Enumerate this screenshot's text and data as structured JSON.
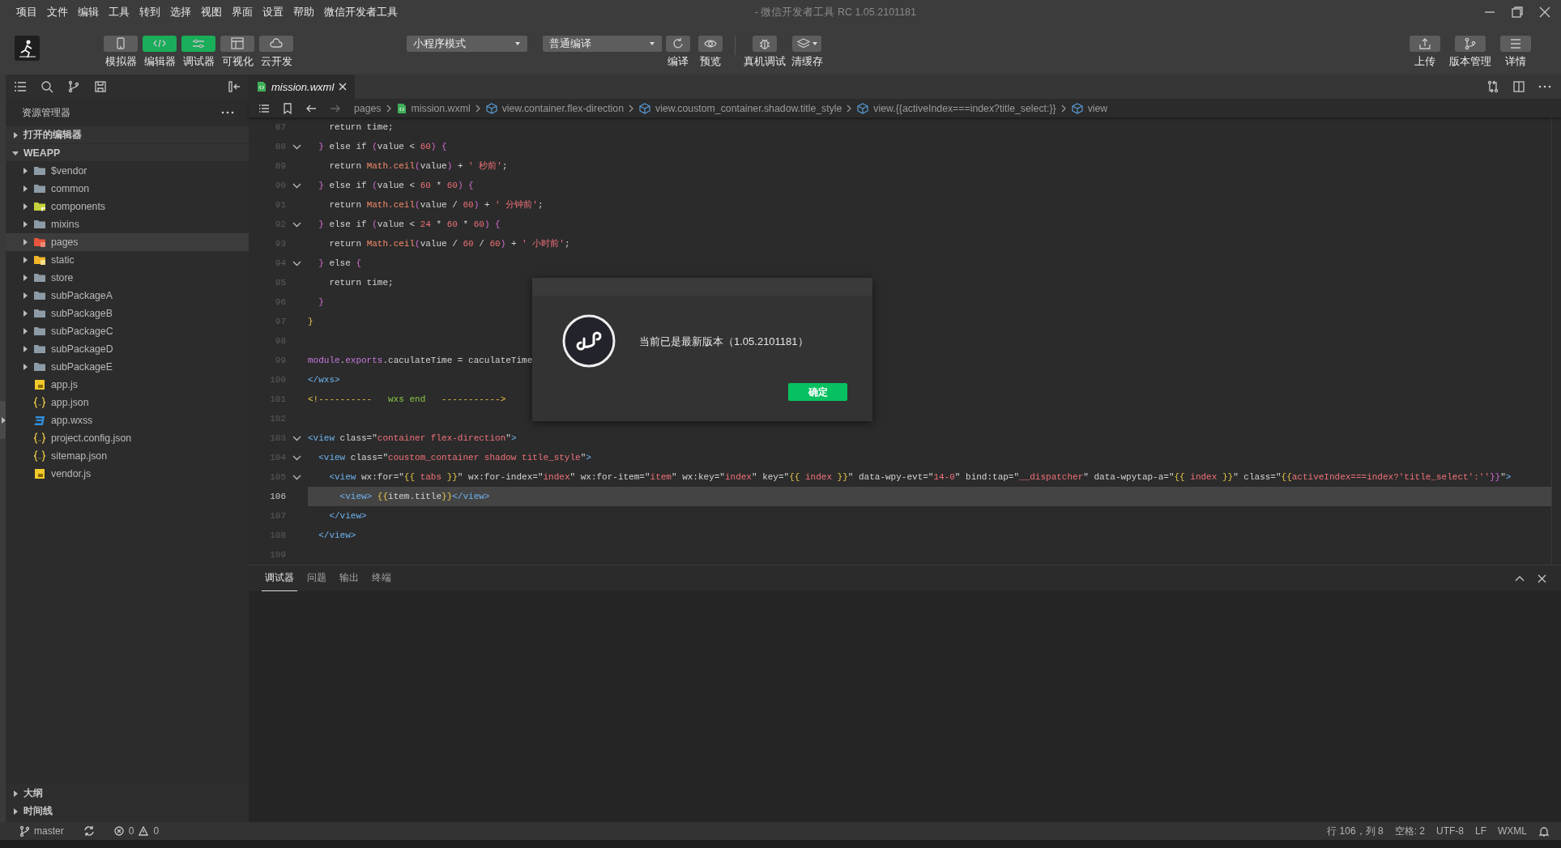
{
  "window": {
    "title": "- 微信开发者工具 RC 1.05.2101181"
  },
  "menu": [
    "项目",
    "文件",
    "编辑",
    "工具",
    "转到",
    "选择",
    "视图",
    "界面",
    "设置",
    "帮助",
    "微信开发者工具"
  ],
  "toolbar": {
    "views": [
      {
        "label": "模拟器",
        "on": false
      },
      {
        "label": "编辑器",
        "on": true
      },
      {
        "label": "调试器",
        "on": true
      },
      {
        "label": "可视化",
        "on": false
      },
      {
        "label": "云开发",
        "on": false
      }
    ],
    "mode_select": "小程序模式",
    "compile_select": "普通编译",
    "actions": [
      "编译",
      "预览",
      "真机调试",
      "清缓存"
    ],
    "right_actions": [
      "上传",
      "版本管理",
      "详情"
    ]
  },
  "sidebar": {
    "title": "资源管理器",
    "sections": [
      {
        "label": "打开的编辑器",
        "expanded": false
      },
      {
        "label": "WEAPP",
        "expanded": true
      }
    ],
    "items": [
      {
        "name": "$vendor",
        "kind": "folder",
        "selected": false
      },
      {
        "name": "common",
        "kind": "folder",
        "selected": false
      },
      {
        "name": "components",
        "kind": "components",
        "selected": false
      },
      {
        "name": "mixins",
        "kind": "folder",
        "selected": false
      },
      {
        "name": "pages",
        "kind": "pages",
        "selected": true
      },
      {
        "name": "static",
        "kind": "static",
        "selected": false
      },
      {
        "name": "store",
        "kind": "folder",
        "selected": false
      },
      {
        "name": "subPackageA",
        "kind": "folder",
        "selected": false
      },
      {
        "name": "subPackageB",
        "kind": "folder",
        "selected": false
      },
      {
        "name": "subPackageC",
        "kind": "folder",
        "selected": false
      },
      {
        "name": "subPackageD",
        "kind": "folder",
        "selected": false
      },
      {
        "name": "subPackageE",
        "kind": "folder",
        "selected": false
      },
      {
        "name": "app.js",
        "kind": "js",
        "selected": false
      },
      {
        "name": "app.json",
        "kind": "json",
        "selected": false
      },
      {
        "name": "app.wxss",
        "kind": "wxss",
        "selected": false
      },
      {
        "name": "project.config.json",
        "kind": "json",
        "selected": false
      },
      {
        "name": "sitemap.json",
        "kind": "json",
        "selected": false
      },
      {
        "name": "vendor.js",
        "kind": "js",
        "selected": false
      }
    ],
    "bottom_sections": [
      {
        "label": "大纲",
        "expanded": false
      },
      {
        "label": "时间线",
        "expanded": false
      }
    ]
  },
  "editor": {
    "tabs": [
      {
        "label": "mission.wxml",
        "selected": true
      }
    ],
    "breadcrumb": [
      {
        "label": "pages",
        "kind": "folder"
      },
      {
        "label": "mission.wxml",
        "kind": "file"
      },
      {
        "label": "view.container.flex-direction",
        "kind": "element"
      },
      {
        "label": "view.coustom_container.shadow.title_style",
        "kind": "element"
      },
      {
        "label": "view.{{activeIndex===index?title_select:}}",
        "kind": "element"
      },
      {
        "label": "view",
        "kind": "element"
      }
    ],
    "lines": [
      {
        "number": "87",
        "fold": false,
        "current": false,
        "tokens": [
          {
            "kind": "t",
            "text": "    return time;"
          }
        ]
      },
      {
        "number": "88",
        "fold": true,
        "current": false,
        "tokens": [
          {
            "kind": "br",
            "text": "  }"
          },
          {
            "kind": "t",
            "text": " else if "
          },
          {
            "kind": "br",
            "text": "("
          },
          {
            "kind": "t",
            "text": "value < "
          },
          {
            "kind": "num",
            "text": "60"
          },
          {
            "kind": "br",
            "text": ") {"
          }
        ]
      },
      {
        "number": "89",
        "fold": false,
        "current": false,
        "tokens": [
          {
            "kind": "t",
            "text": "    return "
          },
          {
            "kind": "fn",
            "text": "Math.ceil"
          },
          {
            "kind": "br",
            "text": "("
          },
          {
            "kind": "t",
            "text": "value"
          },
          {
            "kind": "br",
            "text": ")"
          },
          {
            "kind": "t",
            "text": " + "
          },
          {
            "kind": "str",
            "text": "' 秒前'"
          },
          {
            "kind": "t",
            "text": ";"
          }
        ]
      },
      {
        "number": "90",
        "fold": true,
        "current": false,
        "tokens": [
          {
            "kind": "br",
            "text": "  }"
          },
          {
            "kind": "t",
            "text": " else if "
          },
          {
            "kind": "br",
            "text": "("
          },
          {
            "kind": "t",
            "text": "value < "
          },
          {
            "kind": "num",
            "text": "60"
          },
          {
            "kind": "t",
            "text": " * "
          },
          {
            "kind": "num",
            "text": "60"
          },
          {
            "kind": "br",
            "text": ") {"
          }
        ]
      },
      {
        "number": "91",
        "fold": false,
        "current": false,
        "tokens": [
          {
            "kind": "t",
            "text": "    return "
          },
          {
            "kind": "fn",
            "text": "Math.ceil"
          },
          {
            "kind": "br",
            "text": "("
          },
          {
            "kind": "t",
            "text": "value / "
          },
          {
            "kind": "num",
            "text": "60"
          },
          {
            "kind": "br",
            "text": ")"
          },
          {
            "kind": "t",
            "text": " + "
          },
          {
            "kind": "str",
            "text": "' 分钟前'"
          },
          {
            "kind": "t",
            "text": ";"
          }
        ]
      },
      {
        "number": "92",
        "fold": true,
        "current": false,
        "tokens": [
          {
            "kind": "br",
            "text": "  }"
          },
          {
            "kind": "t",
            "text": " else if "
          },
          {
            "kind": "br",
            "text": "("
          },
          {
            "kind": "t",
            "text": "value < "
          },
          {
            "kind": "num",
            "text": "24"
          },
          {
            "kind": "t",
            "text": " * "
          },
          {
            "kind": "num",
            "text": "60"
          },
          {
            "kind": "t",
            "text": " * "
          },
          {
            "kind": "num",
            "text": "60"
          },
          {
            "kind": "br",
            "text": ") {"
          }
        ]
      },
      {
        "number": "93",
        "fold": false,
        "current": false,
        "tokens": [
          {
            "kind": "t",
            "text": "    return "
          },
          {
            "kind": "fn",
            "text": "Math.ceil"
          },
          {
            "kind": "br",
            "text": "("
          },
          {
            "kind": "t",
            "text": "value / "
          },
          {
            "kind": "num",
            "text": "60"
          },
          {
            "kind": "t",
            "text": " / "
          },
          {
            "kind": "num",
            "text": "60"
          },
          {
            "kind": "br",
            "text": ")"
          },
          {
            "kind": "t",
            "text": " + "
          },
          {
            "kind": "str",
            "text": "' 小时前'"
          },
          {
            "kind": "t",
            "text": ";"
          }
        ]
      },
      {
        "number": "94",
        "fold": true,
        "current": false,
        "tokens": [
          {
            "kind": "br",
            "text": "  }"
          },
          {
            "kind": "t",
            "text": " else "
          },
          {
            "kind": "br",
            "text": "{"
          }
        ]
      },
      {
        "number": "95",
        "fold": false,
        "current": false,
        "tokens": [
          {
            "kind": "t",
            "text": "    return time;"
          }
        ]
      },
      {
        "number": "96",
        "fold": false,
        "current": false,
        "tokens": [
          {
            "kind": "br",
            "text": "  }"
          }
        ]
      },
      {
        "number": "97",
        "fold": false,
        "current": false,
        "tokens": [
          {
            "kind": "br2",
            "text": "}"
          }
        ]
      },
      {
        "number": "98",
        "fold": false,
        "current": false
      },
      {
        "number": "99",
        "fold": false,
        "current": false,
        "tokens": [
          {
            "kind": "mod",
            "text": "module"
          },
          {
            "kind": "t",
            "text": "."
          },
          {
            "kind": "mod",
            "text": "exports"
          },
          {
            "kind": "t",
            "text": ".caculateTime = caculateTime"
          }
        ]
      },
      {
        "number": "100",
        "fold": false,
        "current": false,
        "tokens": [
          {
            "kind": "tag",
            "text": "</wxs>"
          }
        ]
      },
      {
        "number": "101",
        "fold": false,
        "current": false,
        "tokens": [
          {
            "kind": "cm",
            "text": "<!----------"
          },
          {
            "kind": "cg",
            "text": "   wxs end   "
          },
          {
            "kind": "cm",
            "text": "----------->"
          }
        ]
      },
      {
        "number": "102",
        "fold": false,
        "current": false
      },
      {
        "number": "103",
        "fold": true,
        "current": false,
        "tokens": [
          {
            "kind": "tag",
            "text": "<view"
          },
          {
            "kind": "t",
            "text": " class=\""
          },
          {
            "kind": "str",
            "text": "container flex-direction"
          },
          {
            "kind": "t",
            "text": "\""
          },
          {
            "kind": "tag",
            "text": ">"
          }
        ]
      },
      {
        "number": "104",
        "fold": true,
        "current": false,
        "tokens": [
          {
            "kind": "tag",
            "text": "  <view"
          },
          {
            "kind": "t",
            "text": " class=\""
          },
          {
            "kind": "str",
            "text": "coustom_container shadow title_style"
          },
          {
            "kind": "t",
            "text": "\""
          },
          {
            "kind": "tag",
            "text": ">"
          }
        ]
      },
      {
        "number": "105",
        "fold": true,
        "current": false,
        "tokens": [
          {
            "kind": "tag",
            "text": "    <view"
          },
          {
            "kind": "t",
            "text": " wx:for=\""
          },
          {
            "kind": "br2",
            "text": "{{"
          },
          {
            "kind": "str",
            "text": " tabs "
          },
          {
            "kind": "br2",
            "text": "}}"
          },
          {
            "kind": "t",
            "text": "\" wx:for-index=\""
          },
          {
            "kind": "str",
            "text": "index"
          },
          {
            "kind": "t",
            "text": "\" wx:for-item=\""
          },
          {
            "kind": "str",
            "text": "item"
          },
          {
            "kind": "t",
            "text": "\" wx:key=\""
          },
          {
            "kind": "str",
            "text": "index"
          },
          {
            "kind": "t",
            "text": "\" key=\""
          },
          {
            "kind": "br2",
            "text": "{{"
          },
          {
            "kind": "str",
            "text": " index "
          },
          {
            "kind": "br2",
            "text": "}}"
          },
          {
            "kind": "t",
            "text": "\" data-wpy-evt=\""
          },
          {
            "kind": "str",
            "text": "14-0"
          },
          {
            "kind": "t",
            "text": "\" bind:tap=\""
          },
          {
            "kind": "str",
            "text": "__dispatcher"
          },
          {
            "kind": "t",
            "text": "\" data-wpytap-a=\""
          },
          {
            "kind": "br2",
            "text": "{{"
          },
          {
            "kind": "str",
            "text": " index "
          },
          {
            "kind": "br2",
            "text": "}}"
          },
          {
            "kind": "t",
            "text": "\" class=\""
          },
          {
            "kind": "br2",
            "text": "{{"
          },
          {
            "kind": "str",
            "text": "activeIndex===index?'title_select':''"
          },
          {
            "kind": "br",
            "text": "}}"
          },
          {
            "kind": "t",
            "text": "\""
          },
          {
            "kind": "tag",
            "text": ">"
          }
        ]
      },
      {
        "number": "106",
        "fold": false,
        "current": true,
        "tokens": [
          {
            "kind": "tag",
            "text": "      <view> "
          },
          {
            "kind": "br2",
            "text": "{{"
          },
          {
            "kind": "t",
            "text": "item.title"
          },
          {
            "kind": "br2",
            "text": "}}"
          },
          {
            "kind": "tag",
            "text": "</view>"
          }
        ]
      },
      {
        "number": "107",
        "fold": false,
        "current": false,
        "tokens": [
          {
            "kind": "tag",
            "text": "    </view>"
          }
        ]
      },
      {
        "number": "108",
        "fold": false,
        "current": false,
        "tokens": [
          {
            "kind": "tag",
            "text": "  </view>"
          }
        ]
      },
      {
        "number": "109",
        "fold": false,
        "current": false
      }
    ]
  },
  "dialog": {
    "message": "当前已是最新版本（1.05.2101181）",
    "button": "确定"
  },
  "panel": {
    "tabs": [
      {
        "label": "调试器",
        "selected": true
      },
      {
        "label": "问题",
        "selected": false
      },
      {
        "label": "输出",
        "selected": false
      },
      {
        "label": "终端",
        "selected": false
      }
    ]
  },
  "status_bar": {
    "branch": "master",
    "errors": "0",
    "warnings": "0",
    "items": [
      "行 106，列 8",
      "空格: 2",
      "UTF-8",
      "LF",
      "WXML"
    ]
  }
}
